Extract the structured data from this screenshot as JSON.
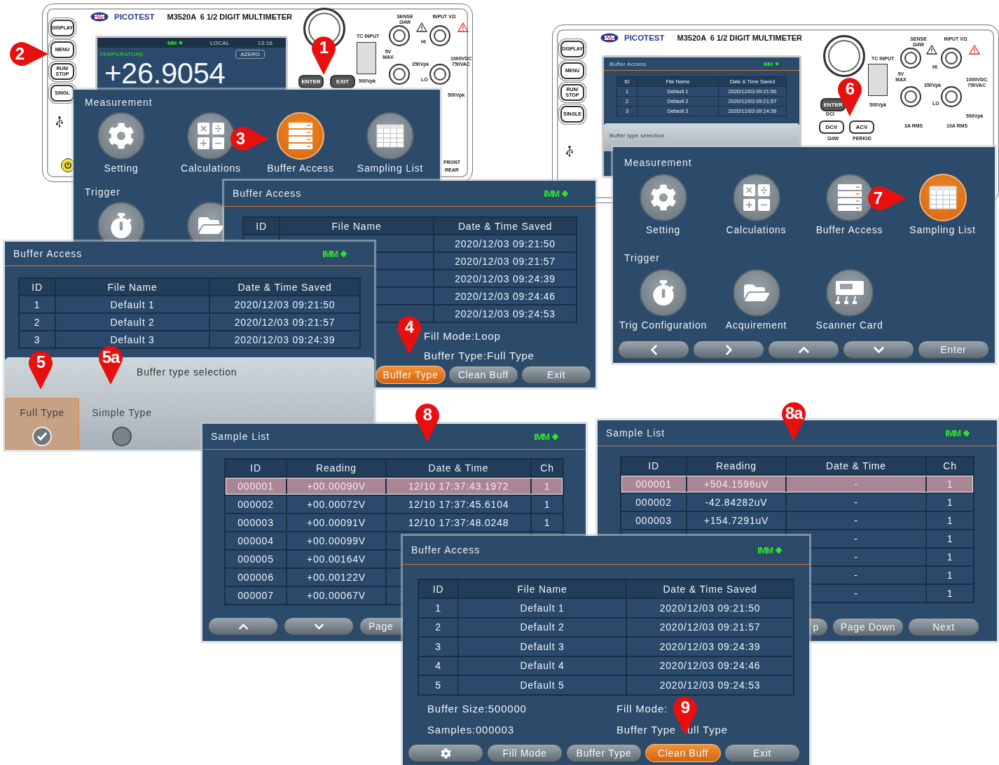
{
  "devices": [
    {
      "brand": "PICOTEST",
      "model": "M3520A  6 1/2 DIGIT MULTIMETER",
      "side_keys": [
        "DISPLAY",
        "MENU",
        "RUN/ STOP",
        "SINGL"
      ],
      "screen": {
        "kind": "reading",
        "mode": "IMM",
        "remote": "LOCAL",
        "time": "13:16",
        "function": "TEMPERATURE",
        "badge": "AZERO",
        "reading": "+26.9054"
      },
      "keys": [
        "ENTER",
        "EXIT"
      ],
      "terminal_labels": [
        "TC INPUT",
        "5V MAX",
        "500Vpk",
        "SENSE Ω4W",
        "INPUT VΩ",
        "HI",
        "350Vpk",
        "1000VDC 750VAC",
        "LO",
        "500Vpk",
        "FRONT",
        "REAR"
      ]
    },
    {
      "brand": "PICOTEST",
      "model": "M3520A  6 1/2 DIGIT MULTIMETER",
      "side_keys": [
        "DISPLAY",
        "MENU",
        "RUN/ STOP",
        "SINGLE"
      ],
      "screen": {
        "kind": "buffer",
        "title": "Buffer Access",
        "mode": "IMM",
        "columns": [
          "ID",
          "File Name",
          "Date & Time Saved"
        ],
        "rows": [
          [
            "1",
            "Default 1",
            "2020/12/03 09:21:50"
          ],
          [
            "2",
            "Default 2",
            "2020/12/03 09:21:57"
          ],
          [
            "3",
            "Default 3",
            "2020/12/03 09:24:39"
          ]
        ],
        "popup_title": "Buffer type selection"
      },
      "keys": [
        "ENTER",
        "DCV",
        "ACV"
      ],
      "terminal_labels": [
        "TC INPUT",
        "5V MAX",
        "500Vpk",
        "SENSE Ω4W",
        "INPUT VΩ",
        "HI",
        "350Vpk",
        "1000VDC 750VAC",
        "LO",
        "500Vpk",
        "DCI",
        "Ω4W",
        "PERIOD",
        "3A RMS",
        "10A RMS"
      ]
    }
  ],
  "menus": [
    {
      "sections": [
        {
          "title": "Measurement",
          "items": [
            {
              "label": "Setting",
              "kind": "gear",
              "selected": false
            },
            {
              "label": "Calculations",
              "kind": "calculator",
              "selected": false
            },
            {
              "label": "Buffer Access",
              "kind": "buffer",
              "selected": true
            },
            {
              "label": "Sampling List",
              "kind": "table",
              "selected": false
            }
          ]
        },
        {
          "title": "Trigger",
          "items": [
            {
              "kind": "stopwatch",
              "selected": false
            },
            {
              "kind": "folder",
              "selected": false
            }
          ]
        }
      ]
    },
    {
      "sections": [
        {
          "title": "Measurement",
          "items": [
            {
              "label": "Setting",
              "kind": "gear",
              "selected": false
            },
            {
              "label": "Calculations",
              "kind": "calculator",
              "selected": false
            },
            {
              "label": "Buffer Access",
              "kind": "buffer",
              "selected": false
            },
            {
              "label": "Sampling List",
              "kind": "table",
              "selected": true
            }
          ]
        },
        {
          "title": "Trigger",
          "items": [
            {
              "label": "Trig Configuration",
              "kind": "stopwatch",
              "selected": false
            },
            {
              "label": "Acquirement",
              "kind": "folder",
              "selected": false
            },
            {
              "label": "Scanner Card",
              "kind": "scanner",
              "selected": false
            }
          ]
        }
      ],
      "nav": [
        {
          "kind": "left"
        },
        {
          "kind": "right"
        },
        {
          "kind": "up"
        },
        {
          "kind": "down"
        },
        {
          "label": "Enter"
        }
      ]
    }
  ],
  "buffer_panels": [
    {
      "title": "Buffer Access",
      "mode": "IMM",
      "columns": [
        "ID",
        "File Name",
        "Date & Time Saved"
      ],
      "rows": [
        {
          "date": "2020/12/03 09:21:50"
        },
        {
          "date": "2020/12/03 09:21:57"
        },
        {
          "date": "2020/12/03 09:24:39"
        },
        {
          "date": "2020/12/03 09:24:46"
        },
        {
          "date": "2020/12/03 09:24:53"
        }
      ],
      "info_right": [
        [
          "Fill Mode:Loop"
        ],
        [
          "Buffer Type:Full Type"
        ]
      ],
      "buttons": [
        {
          "label": "Buffer Type",
          "selected": true
        },
        {
          "label": "Clean Buff",
          "selected": false
        },
        {
          "label": "Exit",
          "selected": false
        }
      ]
    },
    {
      "title": "Buffer Access",
      "mode": "IMM",
      "columns": [
        "ID",
        "File Name",
        "Date & Time Saved"
      ],
      "rows": [
        {
          "id": "1",
          "file_name": "Default 1",
          "date": "2020/12/03 09:21:50"
        },
        {
          "id": "2",
          "file_name": "Default 2",
          "date": "2020/12/03 09:21:57"
        },
        {
          "id": "3",
          "file_name": "Default 3",
          "date": "2020/12/03 09:24:39"
        }
      ],
      "popup": {
        "title": "Buffer type selection",
        "options": [
          {
            "label": "Full Type",
            "selected": true
          },
          {
            "label": "Simple Type",
            "selected": false
          }
        ]
      }
    },
    {
      "title": "Buffer Access",
      "mode": "IMM",
      "columns": [
        "ID",
        "File Name",
        "Date & Time Saved"
      ],
      "rows": [
        {
          "id": "1",
          "file_name": "Default 1",
          "date": "2020/12/03 09:21:50"
        },
        {
          "id": "2",
          "file_name": "Default 2",
          "date": "2020/12/03 09:21:57"
        },
        {
          "id": "3",
          "file_name": "Default 3",
          "date": "2020/12/03 09:24:39"
        },
        {
          "id": "4",
          "file_name": "Default 4",
          "date": "2020/12/03 09:24:46"
        },
        {
          "id": "5",
          "file_name": "Default 5",
          "date": "2020/12/03 09:24:53"
        }
      ],
      "info_left": [
        [
          "Buffer Size:500000"
        ],
        [
          "Samples:000003"
        ]
      ],
      "info_right": [
        [
          "Fill Mode:"
        ],
        [
          "Buffer Type",
          "ull Type"
        ]
      ],
      "buttons": [
        {
          "kind": "gear",
          "selected": false
        },
        {
          "label": "Fill Mode",
          "selected": false
        },
        {
          "label": "Buffer Type",
          "selected": false
        },
        {
          "label": "Clean Buff",
          "selected": true
        },
        {
          "label": "Exit",
          "selected": false
        }
      ]
    }
  ],
  "sample_lists": [
    {
      "title": "Sample List",
      "mode": "IMM",
      "columns": [
        "ID",
        "Reading",
        "Date & Time",
        "Ch"
      ],
      "rows": [
        {
          "id": "000001",
          "reading": "+00.00090V",
          "date": "12/10  17:37:43.1972",
          "ch": "1",
          "selected": true
        },
        {
          "id": "000002",
          "reading": "+00.00072V",
          "date": "12/10  17:37:45.6104",
          "ch": "1",
          "selected": false
        },
        {
          "id": "000003",
          "reading": "+00.00091V",
          "date": "12/10  17:37:48.0248",
          "ch": "1",
          "selected": false
        },
        {
          "id": "000004",
          "reading": "+00.00099V",
          "selected": false
        },
        {
          "id": "000005",
          "reading": "+00.00164V",
          "selected": false
        },
        {
          "id": "000006",
          "reading": "+00.00122V",
          "selected": false
        },
        {
          "id": "000007",
          "reading": "+00.00067V",
          "selected": false
        }
      ],
      "buttons": [
        {
          "kind": "up"
        },
        {
          "kind": "down"
        },
        {
          "label": "Page"
        }
      ]
    },
    {
      "title": "Sample List",
      "mode": "IMM",
      "columns": [
        "ID",
        "Reading",
        "Date & Time",
        "Ch"
      ],
      "rows": [
        {
          "id": "000001",
          "reading": "+504.1596uV",
          "date": "-",
          "ch": "1",
          "selected": true
        },
        {
          "id": "000002",
          "reading": "-42.84282uV",
          "date": "-",
          "ch": "1",
          "selected": false
        },
        {
          "id": "000003",
          "reading": "+154.7291uV",
          "date": "-",
          "ch": "1",
          "selected": false
        },
        {
          "date": "-",
          "ch": "1",
          "selected": false
        },
        {
          "date": "-",
          "ch": "1",
          "selected": false
        },
        {
          "date": "-",
          "ch": "1",
          "selected": false
        },
        {
          "date": "-",
          "ch": "1",
          "selected": false
        }
      ],
      "buttons": [
        {
          "label": "p"
        },
        {
          "label": "Page Down"
        },
        {
          "label": "Next"
        }
      ]
    }
  ],
  "markers": [
    {
      "label": "1",
      "kind": "pin"
    },
    {
      "label": "2",
      "kind": "pointer"
    },
    {
      "label": "3",
      "kind": "pointer"
    },
    {
      "label": "4",
      "kind": "pin"
    },
    {
      "label": "5",
      "kind": "pin"
    },
    {
      "label": "5a",
      "kind": "pin"
    },
    {
      "label": "6",
      "kind": "pin"
    },
    {
      "label": "7",
      "kind": "pointer"
    },
    {
      "label": "8",
      "kind": "pin"
    },
    {
      "label": "8a",
      "kind": "pin"
    },
    {
      "label": "9",
      "kind": "pin"
    }
  ]
}
